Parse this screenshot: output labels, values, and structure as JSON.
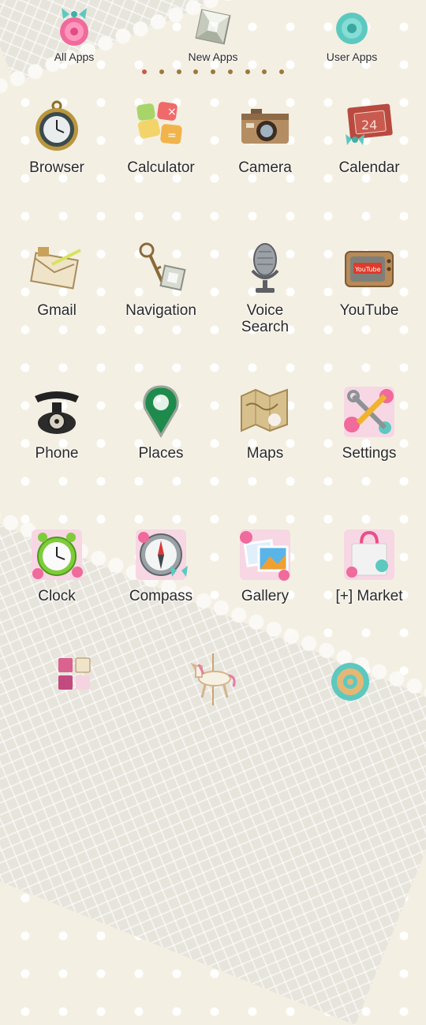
{
  "tabs": [
    {
      "label": "All Apps",
      "icon": "pink-flower-bow-icon"
    },
    {
      "label": "New Apps",
      "icon": "gem-icon"
    },
    {
      "label": "User Apps",
      "icon": "teal-flower-icon"
    }
  ],
  "page_indicator": {
    "count": 9,
    "active": 0
  },
  "apps": [
    {
      "label": "Browser",
      "icon": "pocket-watch-icon"
    },
    {
      "label": "Calculator",
      "icon": "calculator-tiles-icon"
    },
    {
      "label": "Camera",
      "icon": "vintage-camera-icon"
    },
    {
      "label": "Calendar",
      "icon": "calendar-card-icon",
      "calendar_day": "24"
    },
    {
      "label": "Gmail",
      "icon": "envelope-pen-icon"
    },
    {
      "label": "Navigation",
      "icon": "key-gem-icon"
    },
    {
      "label": "Voice\nSearch",
      "icon": "microphone-icon"
    },
    {
      "label": "YouTube",
      "icon": "vintage-tv-icon",
      "tv_text": "YouTube"
    },
    {
      "label": "Phone",
      "icon": "rotary-phone-icon"
    },
    {
      "label": "Places",
      "icon": "green-pin-icon"
    },
    {
      "label": "Maps",
      "icon": "map-icon"
    },
    {
      "label": "Settings",
      "icon": "tools-flowers-icon"
    },
    {
      "label": "Clock",
      "icon": "alarm-clock-icon"
    },
    {
      "label": "Compass",
      "icon": "compass-icon"
    },
    {
      "label": "Gallery",
      "icon": "photo-frame-icon"
    },
    {
      "label": "[+] Market",
      "icon": "shopping-bag-icon"
    }
  ],
  "dock": [
    {
      "icon": "app-grid-icon"
    },
    {
      "icon": "carousel-horse-icon"
    },
    {
      "icon": "gear-flower-icon"
    }
  ],
  "colors": {
    "background": "#f4efe3",
    "lace": "#e7e4dc",
    "pink": "#f06a9c",
    "teal": "#5cc9c0",
    "label_text": "#2a2a2a"
  }
}
